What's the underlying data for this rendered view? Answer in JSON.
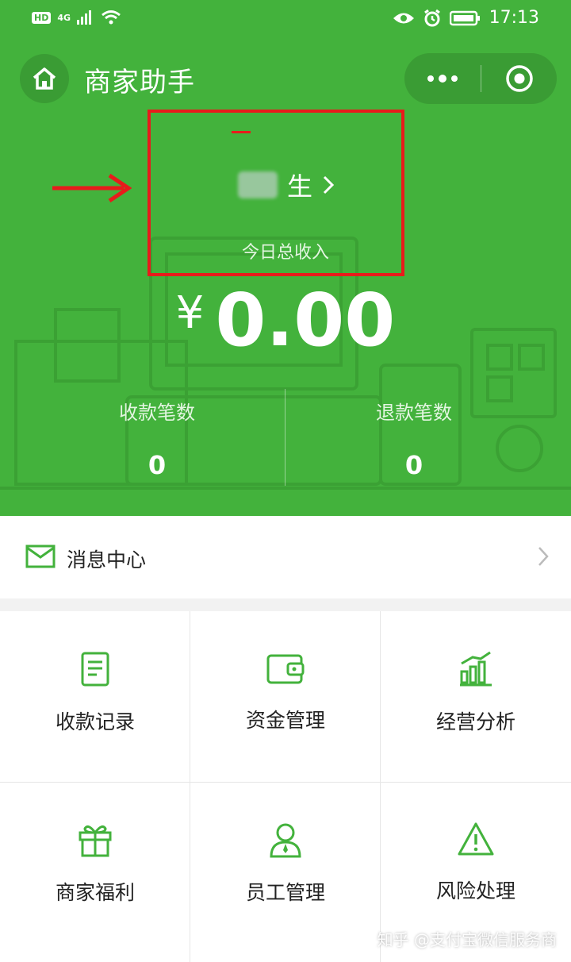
{
  "status_bar": {
    "hd": "HD",
    "network": "4G",
    "time": "17:13"
  },
  "navbar": {
    "title": "商家助手"
  },
  "merchant": {
    "name_suffix": "生",
    "chevron": "›"
  },
  "summary": {
    "income_label": "今日总收入",
    "currency": "¥",
    "amount": "0.00",
    "stats": [
      {
        "label": "收款笔数",
        "value": "0"
      },
      {
        "label": "退款笔数",
        "value": "0"
      }
    ]
  },
  "message_center": {
    "label": "消息中心"
  },
  "grid": [
    {
      "label": "收款记录",
      "icon": "receipt-icon"
    },
    {
      "label": "资金管理",
      "icon": "wallet-icon"
    },
    {
      "label": "经营分析",
      "icon": "bar-chart-icon"
    },
    {
      "label": "商家福利",
      "icon": "gift-icon"
    },
    {
      "label": "员工管理",
      "icon": "staff-icon"
    },
    {
      "label": "风险处理",
      "icon": "warning-icon"
    }
  ],
  "watermark": "知乎 @支付宝微信服务商",
  "colors": {
    "brand_green": "#43b23c",
    "annotation_red": "#e81b1b"
  }
}
